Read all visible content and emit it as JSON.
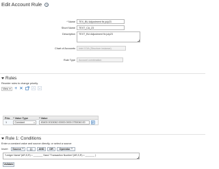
{
  "page": {
    "title": "Edit Account Rule"
  },
  "form": {
    "name_label": "Name",
    "name_value": "TEX_BU Adjustment fix july23",
    "short_name_label": "Short Name",
    "short_name_value": "TEXT_CA_23",
    "description_label": "Description",
    "description_value": "TEXT_BU Adjustment fix july23",
    "chart_label": "Chart of Accounts",
    "chart_value": "Intel COA (Structure instance)",
    "rule_type_label": "Rule Type",
    "rule_type_value": "Account combination"
  },
  "rules": {
    "heading": "Rules",
    "hint": "Reorder rules to change priority.",
    "view_label": "View",
    "columns": {
      "priority": "Prio",
      "value_type": "Value Type",
      "value": "Value"
    },
    "row": {
      "priority": "1",
      "value_type": "Constant",
      "value": "45400.0015062.00000.0000.0750040.00"
    }
  },
  "conditions": {
    "heading": "Rule 1: Conditions",
    "hint": "Enter a constant value and source directly, or select a source",
    "insert_label": "Insert",
    "buttons": {
      "source": "Source",
      "parens": "( )",
      "and": "AND",
      "or": "OR",
      "operator": "Operator"
    },
    "expression": "\"Ledger Name\"(AR,S,R) = _______ Sand \"Transaction Number\"(AR,S,R) = _______ )",
    "validate_label": "Validate"
  },
  "icons": {
    "help": "help-icon",
    "add": "add-icon",
    "delete": "delete-icon",
    "detach": "detach-icon",
    "move_up": "move-up-icon",
    "move_down": "move-down-icon",
    "value_lookup": "value-lookup-icon"
  },
  "colors": {
    "accent": "#2a6fb5",
    "border": "#b6b6b6",
    "disabled_bg": "#f2f2f2"
  }
}
